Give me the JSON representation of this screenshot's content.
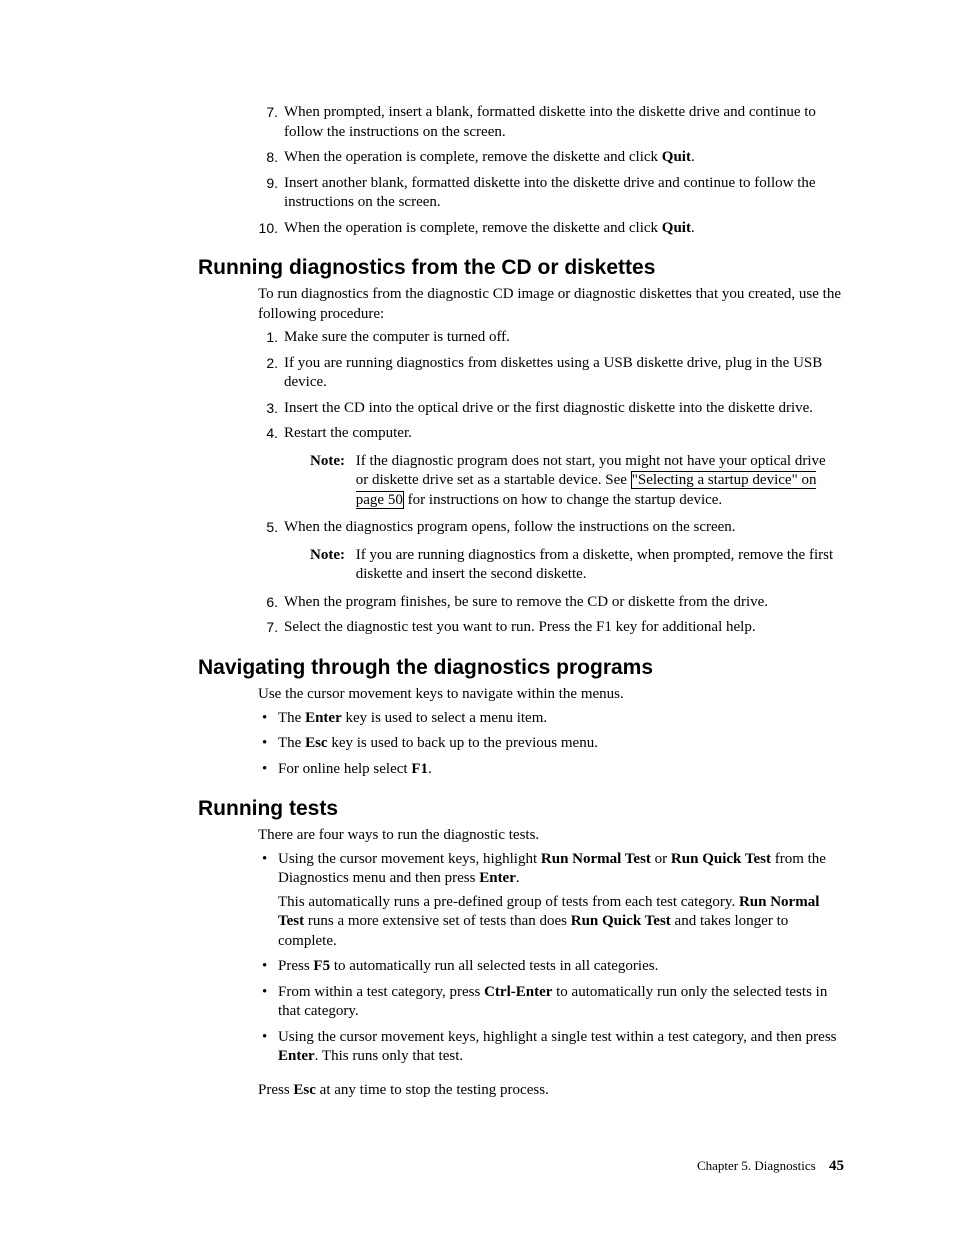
{
  "topList": {
    "items": [
      {
        "num": "7.",
        "text_a": "When prompted, insert a blank, formatted diskette into the diskette drive and continue to follow the instructions on the screen."
      },
      {
        "num": "8.",
        "text_a": "When the operation is complete, remove the diskette and click ",
        "b1": "Quit",
        "text_b": "."
      },
      {
        "num": "9.",
        "text_a": "Insert another blank, formatted diskette into the diskette drive and continue to follow the instructions on the screen."
      },
      {
        "num": "10.",
        "text_a": "When the operation is complete, remove the diskette and click ",
        "b1": "Quit",
        "text_b": "."
      }
    ]
  },
  "section1": {
    "heading": "Running diagnostics from the CD or diskettes",
    "intro": "To run diagnostics from the diagnostic CD image or diagnostic diskettes that you created, use the following procedure:",
    "items": [
      {
        "num": "1.",
        "text_a": "Make sure the computer is turned off."
      },
      {
        "num": "2.",
        "text_a": "If you are running diagnostics from diskettes using a USB diskette drive, plug in the USB device."
      },
      {
        "num": "3.",
        "text_a": "Insert the CD into the optical drive or the first diagnostic diskette into the diskette drive."
      },
      {
        "num": "4.",
        "text_a": "Restart the computer.",
        "note": {
          "label": "Note:",
          "pre": "If the diagnostic program does not start, you might not have your optical drive or diskette drive set as a startable device. See ",
          "link": "\"Selecting a startup device\" on page 50",
          "post": " for instructions on how to change the startup device."
        }
      },
      {
        "num": "5.",
        "text_a": "When the diagnostics program opens, follow the instructions on the screen.",
        "note": {
          "label": "Note:",
          "pre": "If you are running diagnostics from a diskette, when prompted, remove the first diskette and insert the second diskette."
        }
      },
      {
        "num": "6.",
        "text_a": "When the program finishes, be sure to remove the CD or diskette from the drive."
      },
      {
        "num": "7.",
        "text_a": "Select the diagnostic test you want to run. Press the F1 key for additional help."
      }
    ]
  },
  "section2": {
    "heading": "Navigating through the diagnostics programs",
    "intro": "Use the cursor movement keys to navigate within the menus.",
    "items": [
      {
        "pre": "The ",
        "b1": "Enter",
        "post": " key is used to select a menu item."
      },
      {
        "pre": "The ",
        "b1": "Esc",
        "post": " key is used to back up to the previous menu."
      },
      {
        "pre": "For online help select ",
        "b1": "F1",
        "post": "."
      }
    ]
  },
  "section3": {
    "heading": "Running tests",
    "intro": "There are four ways to run the diagnostic tests.",
    "items": [
      {
        "pre": "Using the cursor movement keys, highlight ",
        "b1": "Run Normal Test",
        "mid1": " or ",
        "b2": "Run Quick Test",
        "mid2": " from the Diagnostics menu and then press ",
        "b3": "Enter",
        "post": ".",
        "sub_pre": "This automatically runs a pre-defined group of tests from each test category. ",
        "sub_b1": "Run Normal Test",
        "sub_mid": " runs a more extensive set of tests than does ",
        "sub_b2": "Run Quick Test",
        "sub_post": " and takes longer to complete."
      },
      {
        "pre": "Press ",
        "b1": "F5",
        "post": " to automatically run all selected tests in all categories."
      },
      {
        "pre": "From within a test category, press ",
        "b1": "Ctrl-Enter",
        "post": " to automatically run only the selected tests in that category."
      },
      {
        "pre": "Using the cursor movement keys, highlight a single test within a test category, and then press ",
        "b1": "Enter",
        "post": ". This runs only that test."
      }
    ],
    "closing_pre": "Press ",
    "closing_b": "Esc",
    "closing_post": " at any time to stop the testing process."
  },
  "footer": {
    "chapter": "Chapter 5. Diagnostics",
    "page": "45"
  }
}
